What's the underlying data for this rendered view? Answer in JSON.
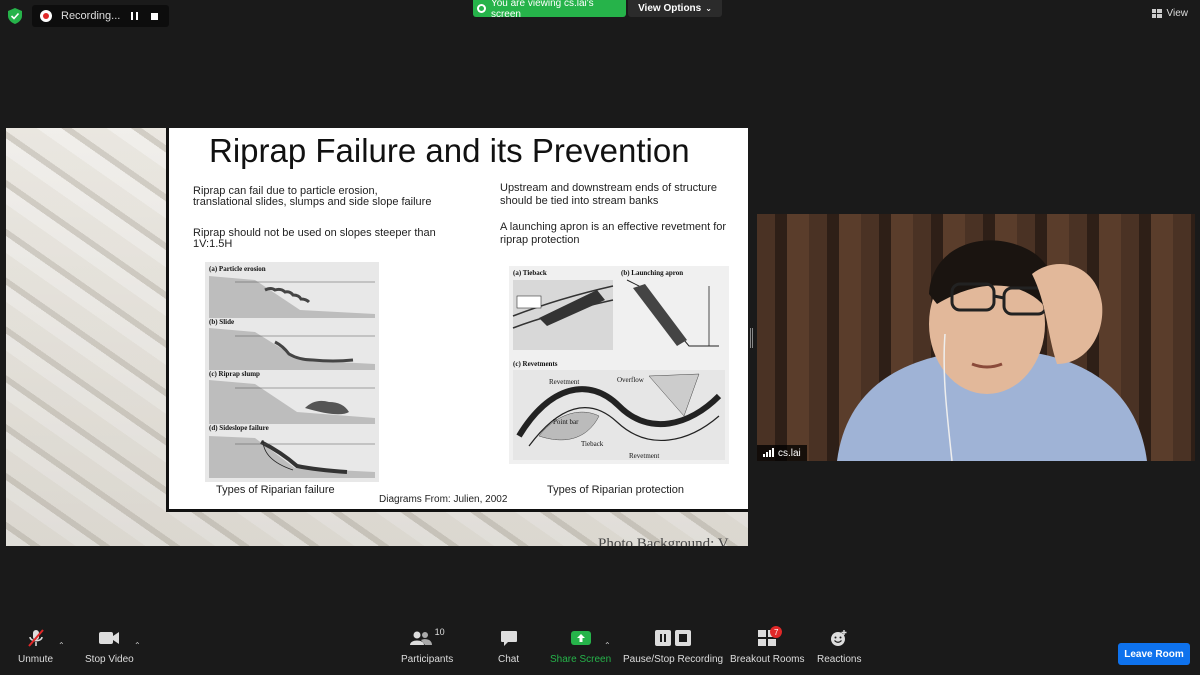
{
  "meeting": {
    "recording_label": "Recording...",
    "viewing_banner": "You are viewing cs.lai's screen",
    "view_options_label": "View Options",
    "view_label": "View",
    "leave_label": "Leave Room",
    "accent_green": "#26b34a",
    "accent_blue": "#0e72ed"
  },
  "slide": {
    "title": "Riprap Failure and its Prevention",
    "left_text_1": "Riprap can fail due to particle erosion, translational slides, slumps and side slope failure",
    "left_text_2": "Riprap should not be used on slopes steeper than 1V:1.5H",
    "right_text_1": "Upstream and downstream ends of structure should be tied into stream banks",
    "right_text_2": "A launching apron is an effective revetment for riprap protection",
    "caption_left": "Types of Riparian failure",
    "caption_right": "Types of Riparian protection",
    "credit": "Diagrams From: Julien, 2002",
    "photo_credit": "Photo Background: V",
    "fig_left_labels": [
      "(a) Particle erosion",
      "(b) Slide",
      "(c) Riprap slump",
      "(d) Sideslope failure"
    ],
    "fig_right_labels": [
      "(a) Tieback",
      "(b) Launching apron",
      "(c) Revetments",
      "Revetment",
      "Point bar",
      "Tieback",
      "Revetment",
      "Overflow"
    ]
  },
  "participant": {
    "name": "cs.lai"
  },
  "toolbar": {
    "unmute": "Unmute",
    "stop_video": "Stop Video",
    "participants": "Participants",
    "participants_count": "10",
    "chat": "Chat",
    "share_screen": "Share Screen",
    "pause_stop_recording": "Pause/Stop Recording",
    "breakout_rooms": "Breakout Rooms",
    "breakout_badge": "7",
    "reactions": "Reactions"
  }
}
